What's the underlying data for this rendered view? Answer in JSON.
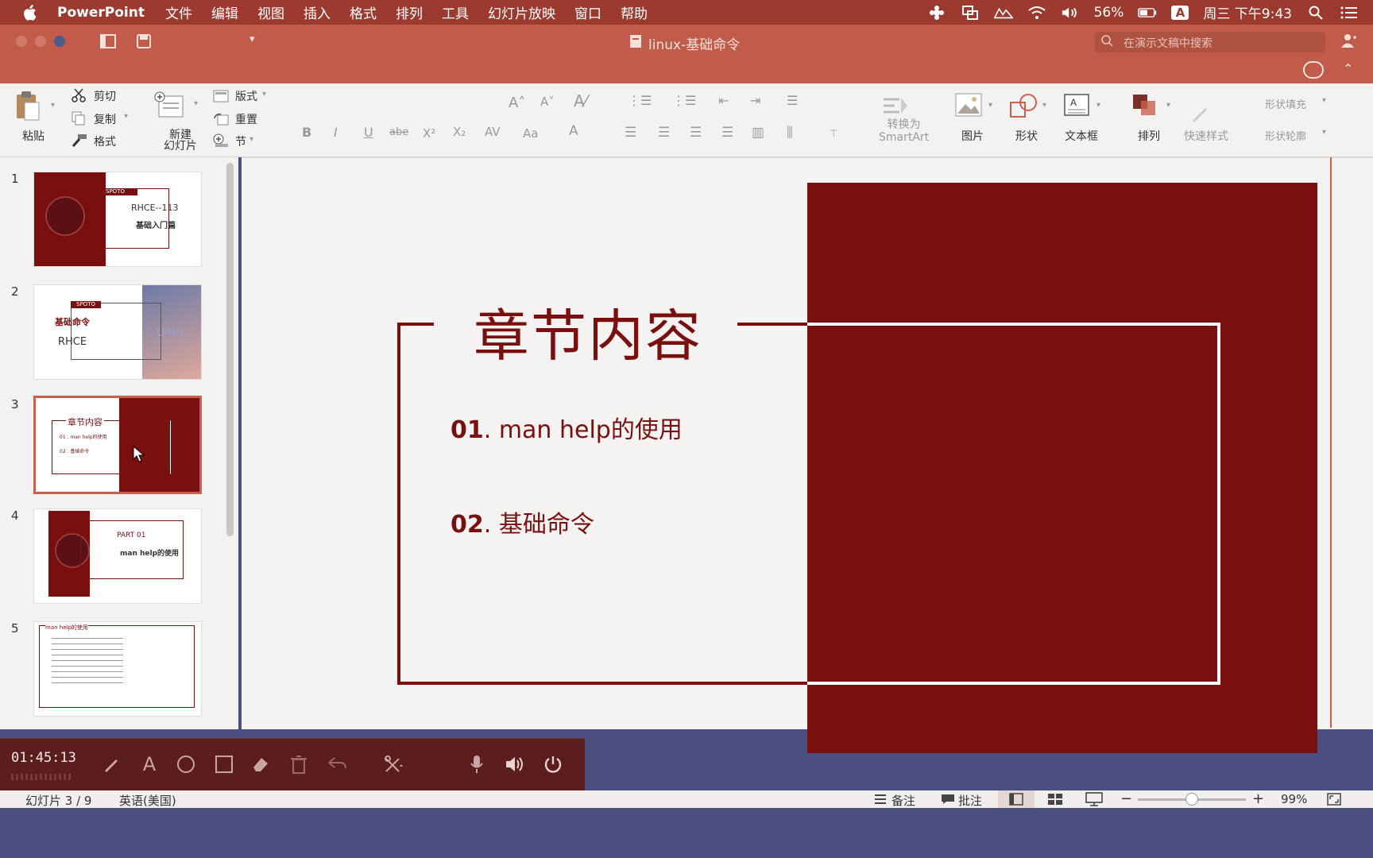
{
  "menubar": {
    "app_name": "PowerPoint",
    "items": [
      "文件",
      "编辑",
      "视图",
      "插入",
      "格式",
      "排列",
      "工具",
      "幻灯片放映",
      "窗口",
      "帮助"
    ],
    "battery": "56%",
    "input_method": "A",
    "clock": "周三 下午9:43"
  },
  "window": {
    "title": "linux-基础命令",
    "search_placeholder": "在演示文稿中搜索"
  },
  "ribbon": {
    "paste": "粘贴",
    "cut": "剪切",
    "copy": "复制",
    "format": "格式",
    "new_slide_line1": "新建",
    "new_slide_line2": "幻灯片",
    "layout": "版式",
    "reset": "重置",
    "section": "节",
    "convert_smartart_line1": "转换为",
    "convert_smartart_line2": "SmartArt",
    "picture": "图片",
    "shape": "形状",
    "textbox": "文本框",
    "arrange": "排列",
    "quick_styles": "快速样式",
    "shape_fill": "形状填充",
    "shape_outline": "形状轮廓"
  },
  "thumbnails": [
    {
      "num": "1",
      "badge": "SPOTO",
      "title": "RHCE--113",
      "subtitle": "基础入门篇"
    },
    {
      "num": "2",
      "badge": "SPOTO",
      "title": "基础命令",
      "subtitle": "RHCE",
      "side": "LINUX"
    },
    {
      "num": "3",
      "title": "章节内容",
      "line1": "01 . man help的使用",
      "line2": "02 . 基础命令"
    },
    {
      "num": "4",
      "title": "PART 01",
      "subtitle": "man help的使用"
    },
    {
      "num": "5",
      "title": "man help的使用"
    }
  ],
  "slide": {
    "title": "章节内容",
    "items": [
      {
        "num": "01",
        "text": ". man  help的使用"
      },
      {
        "num": "02",
        "text": ". 基础命令"
      }
    ]
  },
  "recording": {
    "elapsed": "01:45:13"
  },
  "statusbar": {
    "slide_counter": "幻灯片 3 / 9",
    "language": "英语(美国)",
    "notes": "备注",
    "comments": "批注",
    "zoom": "99%"
  },
  "colors": {
    "accent_dark_red": "#7a0f10",
    "menubar": "#9c3a2f",
    "titlebar": "#c25c4a"
  }
}
